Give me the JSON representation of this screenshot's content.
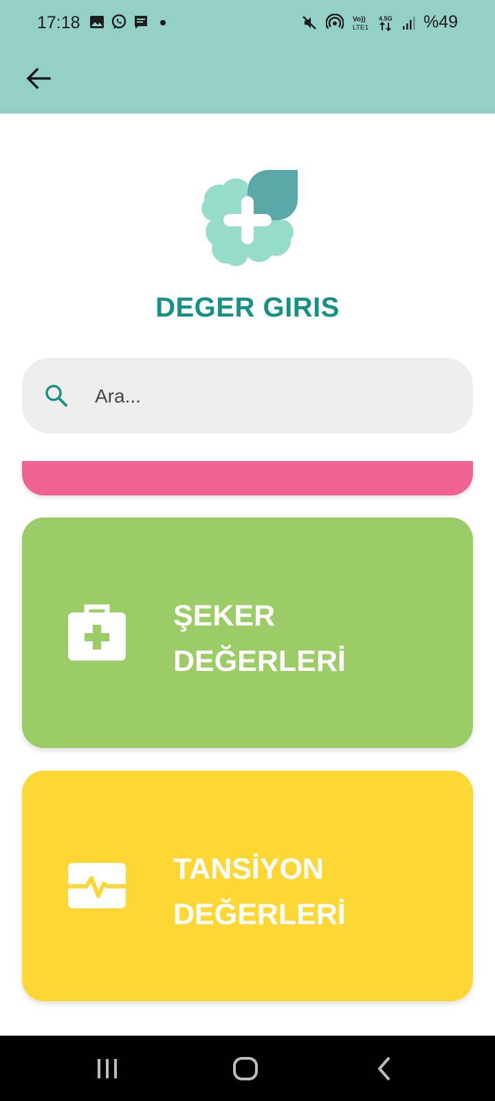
{
  "status_bar": {
    "time": "17:18",
    "battery_text": "%49",
    "left_icons": [
      "image-icon",
      "whatsapp-icon",
      "message-icon",
      "dot-icon"
    ],
    "right_icons": [
      "mute-icon",
      "hotspot-icon",
      "volte-icon",
      "network-4g-icon",
      "signal-icon",
      "battery-icon"
    ],
    "volte_label": "Vo)) LTE1",
    "network_label": "4.5G"
  },
  "app_bar": {
    "back_icon": "arrow-back-icon"
  },
  "header": {
    "title": "DEGER GIRIS",
    "logo_icon": "clover-cross-logo"
  },
  "search": {
    "placeholder": "Ara...",
    "value": "",
    "icon": "search-icon"
  },
  "cards": [
    {
      "label_line1": "",
      "label_line2": "",
      "color": "#f06292"
    },
    {
      "label_line1": "ŞEKER",
      "label_line2": "DEĞERLERİ",
      "icon": "medical-kit-icon",
      "color": "#9ccc65"
    },
    {
      "label_line1": "TANSİYON",
      "label_line2": "DEĞERLERİ",
      "icon": "heart-rate-icon",
      "color": "#fdd835"
    }
  ],
  "colors": {
    "app_bar": "#93d0c6",
    "title": "#169185",
    "logo_light": "#96dccb",
    "logo_dark": "#5aa8a8"
  },
  "nav_bar": {
    "icons": [
      "recent-apps-icon",
      "home-icon",
      "back-icon"
    ]
  }
}
